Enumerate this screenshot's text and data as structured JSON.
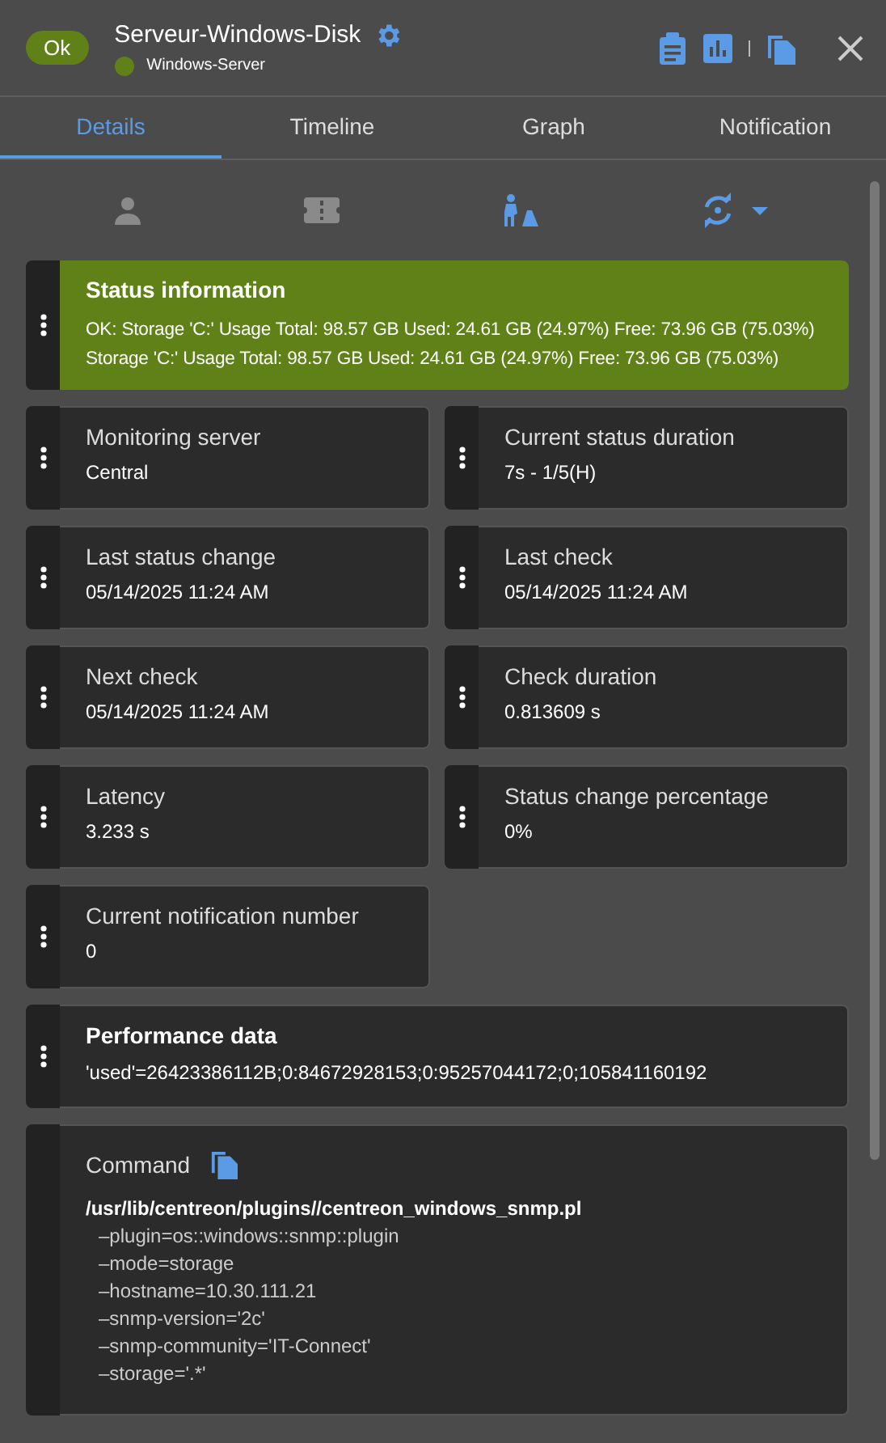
{
  "header": {
    "status": {
      "label": "Ok",
      "color": "#5f8118"
    },
    "title": "Serveur-Windows-Disk",
    "host": {
      "name": "Windows-Server",
      "color": "#5f8118"
    }
  },
  "tabs": [
    {
      "label": "Details",
      "selected": true
    },
    {
      "label": "Timeline",
      "selected": false
    },
    {
      "label": "Graph",
      "selected": false
    },
    {
      "label": "Notification",
      "selected": false
    }
  ],
  "status_information": {
    "title": "Status information",
    "lines": [
      "OK: Storage 'C:' Usage Total: 98.57 GB Used: 24.61 GB (24.97%) Free: 73.96 GB (75.03%)",
      "Storage 'C:' Usage Total: 98.57 GB Used: 24.61 GB (24.97%) Free: 73.96 GB (75.03%)"
    ]
  },
  "details": [
    {
      "label": "Monitoring server",
      "value": "Central"
    },
    {
      "label": "Current status duration",
      "value": "7s - 1/5(H)"
    },
    {
      "label": "Last status change",
      "value": "05/14/2025 11:24 AM"
    },
    {
      "label": "Last check",
      "value": "05/14/2025 11:24 AM"
    },
    {
      "label": "Next check",
      "value": "05/14/2025 11:24 AM"
    },
    {
      "label": "Check duration",
      "value": "0.813609 s"
    },
    {
      "label": "Latency",
      "value": "3.233 s"
    },
    {
      "label": "Status change percentage",
      "value": "0%"
    },
    {
      "label": "Current notification number",
      "value": "0"
    }
  ],
  "performance_data": {
    "title": "Performance data",
    "value": "'used'=26423386112B;0:84672928153;0:95257044172;0;105841160192"
  },
  "command": {
    "title": "Command",
    "path": "/usr/lib/centreon/plugins//centreon_windows_snmp.pl",
    "args": [
      "–plugin=os::windows::snmp::plugin",
      "–mode=storage",
      "–hostname=10.30.111.21",
      "–snmp-version='2c'",
      "–snmp-community='IT-Connect'",
      "–storage='.*'"
    ]
  }
}
